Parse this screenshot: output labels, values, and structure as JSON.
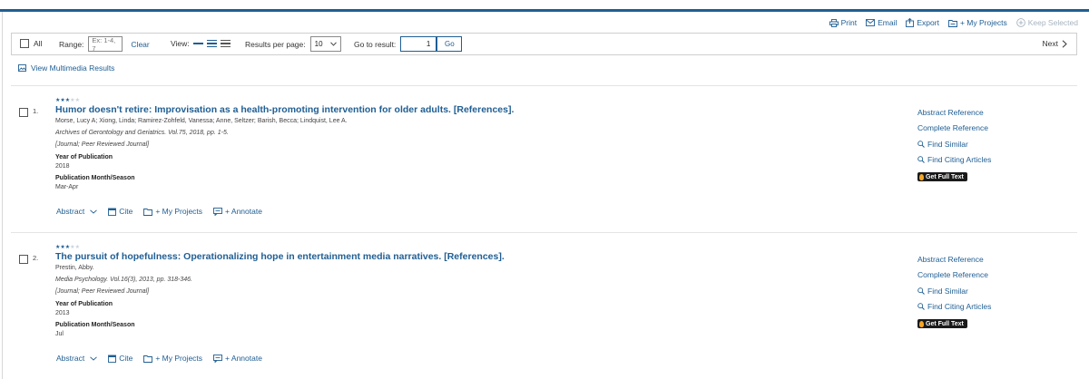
{
  "toolbar": {
    "print_label": "Print",
    "email_label": "Email",
    "export_label": "Export",
    "my_projects_label": "+ My Projects",
    "keep_selected_label": "Keep Selected"
  },
  "controls": {
    "all_label": "All",
    "range_label": "Range:",
    "range_placeholder": "Ex: 1-4, 7",
    "clear_label": "Clear",
    "view_label": "View:",
    "results_per_page_label": "Results per page:",
    "results_per_page_value": "10",
    "go_to_result_label": "Go to result:",
    "go_to_result_value": "1",
    "go_label": "Go",
    "next_label": "Next"
  },
  "multimedia_link": "View Multimedia Results",
  "records": [
    {
      "number": "1.",
      "rating": 3,
      "rating_max": 5,
      "title": "Humor doesn't retire: Improvisation as a health-promoting intervention for older adults. [References].",
      "authors": "Morse, Lucy A; Xiong, Linda; Ramirez-Zohfeld, Vanessa; Anne, Seltzer; Barish, Becca; Lindquist, Lee A.",
      "source": "Archives of Gerontology and Geriatrics. Vol.75, 2018, pp. 1-5.",
      "doc_type": "[Journal; Peer Reviewed Journal]",
      "year_label": "Year of Publication",
      "year": "2018",
      "month_label": "Publication Month/Season",
      "month": "Mar-Apr",
      "actions": {
        "abstract": "Abstract",
        "cite": "Cite",
        "my_projects": "+ My Projects",
        "annotate": "+ Annotate"
      },
      "side": {
        "abstract_ref": "Abstract Reference",
        "complete_ref": "Complete Reference",
        "find_similar": "Find Similar",
        "find_citing": "Find Citing Articles",
        "full_text": "Get Full Text"
      }
    },
    {
      "number": "2.",
      "rating": 3,
      "rating_max": 5,
      "title": "The pursuit of hopefulness: Operationalizing hope in entertainment media narratives. [References].",
      "authors": "Prestin, Abby.",
      "source": "Media Psychology. Vol.16(3), 2013, pp. 318-346.",
      "doc_type": "[Journal; Peer Reviewed Journal]",
      "year_label": "Year of Publication",
      "year": "2013",
      "month_label": "Publication Month/Season",
      "month": "Jul",
      "actions": {
        "abstract": "Abstract",
        "cite": "Cite",
        "my_projects": "+ My Projects",
        "annotate": "+ Annotate"
      },
      "side": {
        "abstract_ref": "Abstract Reference",
        "complete_ref": "Complete Reference",
        "find_similar": "Find Similar",
        "find_citing": "Find Citing Articles",
        "full_text": "Get Full Text"
      }
    }
  ],
  "colors": {
    "accent": "#1f5e93",
    "disabled": "#a8b4c0",
    "full_text_bg": "#1a1a1a"
  },
  "icons": {
    "print": "printer-icon",
    "email": "envelope-icon",
    "export": "export-icon",
    "projects": "folder-icon",
    "keep": "plus-circle-icon",
    "multimedia": "image-icon",
    "cite": "calendar-icon",
    "annotate": "comment-icon",
    "search": "magnifier-icon",
    "expand": "chevron-down-icon",
    "next": "chevron-right-icon"
  }
}
